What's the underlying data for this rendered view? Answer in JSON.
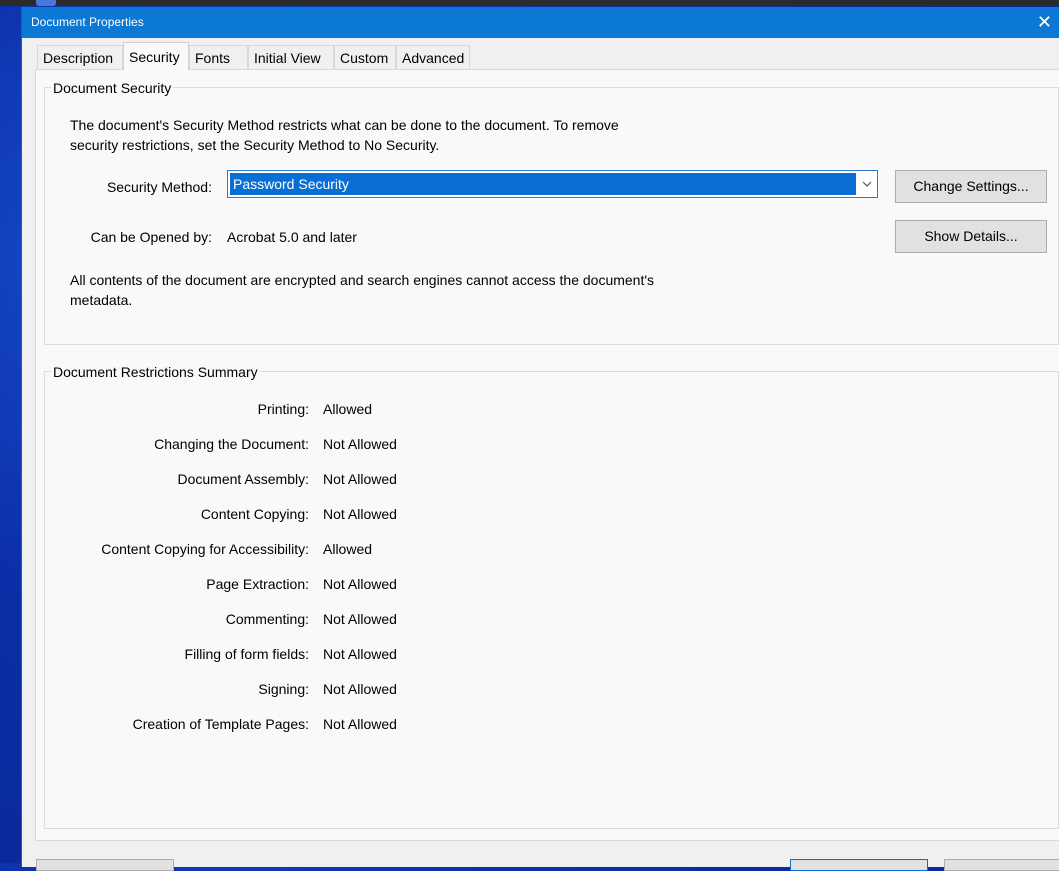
{
  "window": {
    "title": "Document Properties",
    "close_label": "✕"
  },
  "tabs": [
    {
      "label": "Description"
    },
    {
      "label": "Security",
      "active": true
    },
    {
      "label": "Fonts"
    },
    {
      "label": "Initial View"
    },
    {
      "label": "Custom"
    },
    {
      "label": "Advanced"
    }
  ],
  "document_security": {
    "legend": "Document Security",
    "description_line1": "The document's Security Method restricts what can be done to the document. To remove",
    "description_line2": "security restrictions, set the Security Method to No Security.",
    "security_method_label": "Security Method:",
    "security_method_value": "Password Security",
    "change_settings_label": "Change Settings...",
    "opened_by_label": "Can be Opened by:",
    "opened_by_value": "Acrobat 5.0 and later",
    "show_details_label": "Show Details...",
    "encryption_note_line1": "All contents of the document are encrypted and search engines cannot access the document's",
    "encryption_note_line2": "metadata."
  },
  "restrictions": {
    "legend": "Document Restrictions Summary",
    "items": [
      {
        "label": "Printing:",
        "value": "Allowed"
      },
      {
        "label": "Changing the Document:",
        "value": "Not Allowed"
      },
      {
        "label": "Document Assembly:",
        "value": "Not Allowed"
      },
      {
        "label": "Content Copying:",
        "value": "Not Allowed"
      },
      {
        "label": "Content Copying for Accessibility:",
        "value": "Allowed"
      },
      {
        "label": "Page Extraction:",
        "value": "Not Allowed"
      },
      {
        "label": "Commenting:",
        "value": "Not Allowed"
      },
      {
        "label": "Filling of form fields:",
        "value": "Not Allowed"
      },
      {
        "label": "Signing:",
        "value": "Not Allowed"
      },
      {
        "label": "Creation of Template Pages:",
        "value": "Not Allowed"
      }
    ]
  },
  "icons": {
    "close": "close-icon",
    "dropdown": "chevron-down-icon"
  },
  "colors": {
    "titlebar": "#0a78d4",
    "selection": "#0a6fd4",
    "desktop": "#0b2fa8"
  }
}
